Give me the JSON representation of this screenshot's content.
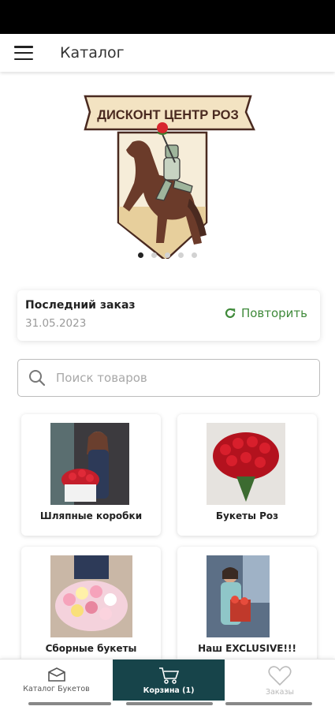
{
  "app_bar": {
    "title": "Каталог",
    "menu_icon": "hamburger-menu-icon"
  },
  "banner": {
    "logo_text": "ДИСКОНТ ЦЕНТР РОЗ",
    "slides": 5,
    "active_slide": 1
  },
  "last_order": {
    "title": "Последний заказ",
    "date": "31.05.2023",
    "repeat_label": "Повторить",
    "repeat_icon": "refresh-icon"
  },
  "search": {
    "placeholder": "Поиск товаров",
    "value": "",
    "icon": "search-icon"
  },
  "categories": [
    {
      "label": "Шляпные коробки"
    },
    {
      "label": "Букеты Роз"
    },
    {
      "label": "Сборные букеты"
    },
    {
      "label": "Наш EXCLUSIVE!!!"
    }
  ],
  "bottom_nav": {
    "catalog": {
      "label": "Каталог Букетов",
      "icon": "flower-box-icon"
    },
    "cart": {
      "label": "Корзина (1)",
      "icon": "shopping-cart-icon",
      "active": true
    },
    "orders": {
      "label": "Заказы",
      "icon": "heart-icon"
    }
  },
  "colors": {
    "accent_green": "#3f8a3a",
    "nav_active_bg": "#17444a",
    "logo_cream": "#f3e3c2",
    "logo_brown": "#6b3b2a"
  }
}
